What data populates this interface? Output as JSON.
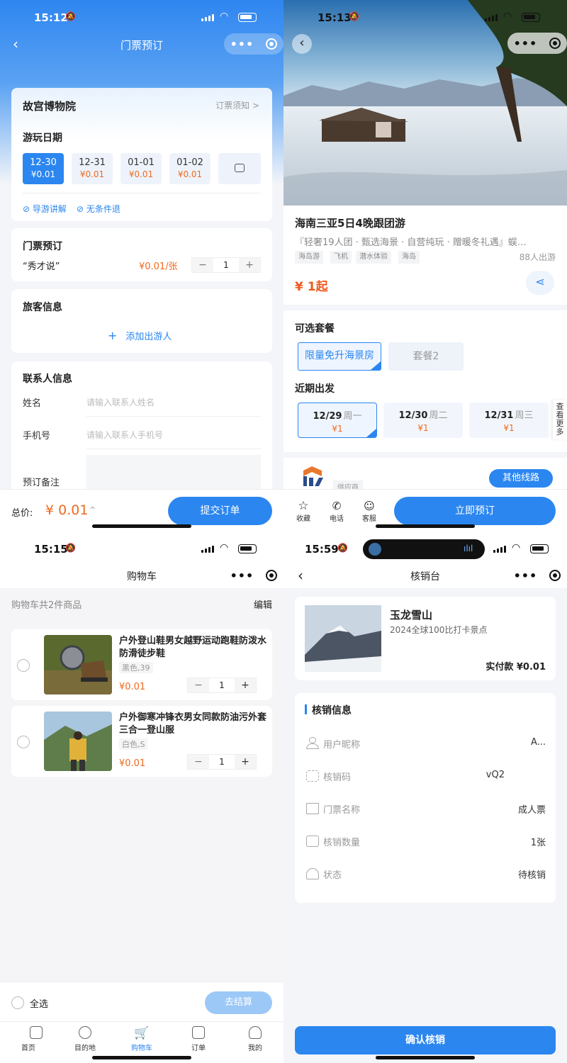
{
  "p1": {
    "time": "15:12",
    "nav_title": "门票预订",
    "venue": "故宫博物院",
    "notice_link": "订票须知 >",
    "date_section": "游玩日期",
    "dates": [
      {
        "date": "12-30",
        "price": "¥0.01",
        "selected": true
      },
      {
        "date": "12-31",
        "price": "¥0.01",
        "selected": false
      },
      {
        "date": "01-01",
        "price": "¥0.01",
        "selected": false
      },
      {
        "date": "01-02",
        "price": "¥0.01",
        "selected": false
      }
    ],
    "features": [
      "导游讲解",
      "无条件退"
    ],
    "ticket_section": "门票预订",
    "ticket_name": "“秀才说”",
    "ticket_price": "¥0.01/张",
    "ticket_qty": "1",
    "traveler_section": "旅客信息",
    "add_traveler": "添加出游人",
    "contact_section": "联系人信息",
    "name_label": "姓名",
    "name_placeholder": "请输入联系人姓名",
    "phone_label": "手机号",
    "phone_placeholder": "请输入联系人手机号",
    "remark_label": "预订备注",
    "total_label": "总价:",
    "total_value": "¥ 0.01",
    "submit": "提交订单"
  },
  "p2": {
    "time": "15:13",
    "title": "海南三亚5日4晚跟团游",
    "subtitle": "『轻奢19人团 · 甄选海景 · 自营纯玩 · 赠暖冬礼遇』蜈…",
    "tags": [
      "海岛游",
      "飞机",
      "潜水体验",
      "海岛"
    ],
    "joined": "88人出游",
    "price": "¥ 1起",
    "package_section": "可选套餐",
    "packages": [
      {
        "label": "限量免升海景房",
        "selected": true
      },
      {
        "label": "套餐2",
        "selected": false
      }
    ],
    "departure_section": "近期出发",
    "departures": [
      {
        "date": "12/29",
        "weekday": "周一",
        "price": "¥1",
        "selected": true
      },
      {
        "date": "12/30",
        "weekday": "周二",
        "price": "¥1",
        "selected": false
      },
      {
        "date": "12/31",
        "weekday": "周三",
        "price": "¥1",
        "selected": false
      }
    ],
    "see_more": "查看更多",
    "supplier_label": "供应商",
    "other_routes": "其他线路",
    "actions": [
      "收藏",
      "电话",
      "客服"
    ],
    "book_now": "立即预订"
  },
  "p3": {
    "time": "15:15",
    "nav_title": "购物车",
    "summary": "购物车共2件商品",
    "edit": "编辑",
    "items": [
      {
        "title": "户外登山鞋男女越野运动跑鞋防泼水防滑徒步鞋",
        "spec": "黑色,39",
        "price": "¥0.01",
        "qty": "1"
      },
      {
        "title": "户外御寒冲锋衣男女同款防油污外套三合一登山服",
        "spec": "白色,S",
        "price": "¥0.01",
        "qty": "1"
      }
    ],
    "select_all": "全选",
    "checkout": "去结算",
    "tabs": [
      "首页",
      "目的地",
      "购物车",
      "订单",
      "我的"
    ],
    "active_tab": "购物车"
  },
  "p4": {
    "time": "15:59",
    "nav_title": "核销台",
    "product_name": "玉龙雪山",
    "product_desc": "2024全球100比打卡景点",
    "paid": "实付款 ¥0.01",
    "section": "核销信息",
    "rows": [
      {
        "label": "用户昵称",
        "value": "A..."
      },
      {
        "label": "核销码",
        "value": "vQ2"
      },
      {
        "label": "门票名称",
        "value": "成人票"
      },
      {
        "label": "核销数量",
        "value": "1张"
      },
      {
        "label": "状态",
        "value": "待核销"
      }
    ],
    "confirm": "确认核销"
  },
  "colors": {
    "brand": "#2b86f0",
    "price": "#ee6a1f"
  }
}
